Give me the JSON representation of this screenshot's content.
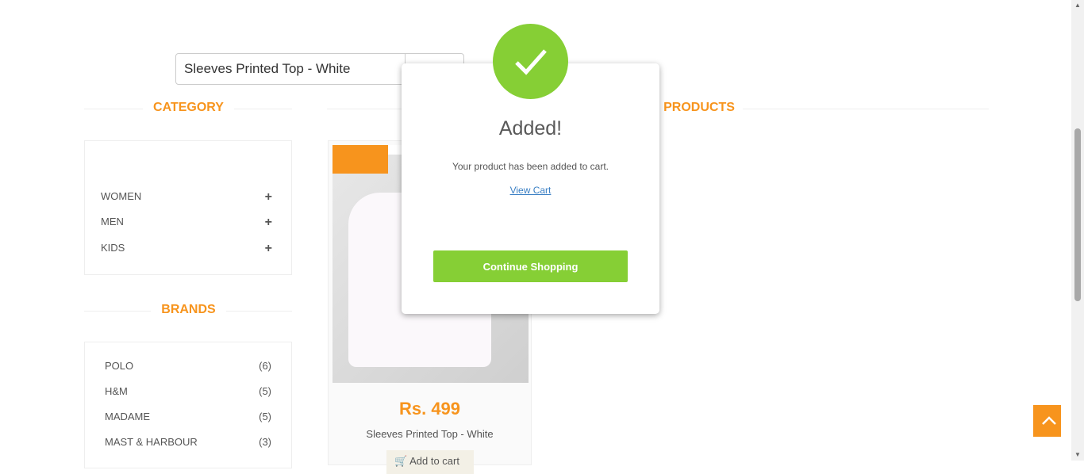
{
  "search": {
    "value": "Sleeves Printed Top - White"
  },
  "sections": {
    "category": "CATEGORY",
    "products": "PRODUCTS",
    "brands": "BRANDS"
  },
  "categories": [
    {
      "label": "WOMEN"
    },
    {
      "label": "MEN"
    },
    {
      "label": "KIDS"
    }
  ],
  "brands": [
    {
      "label": "POLO",
      "count": "(6)"
    },
    {
      "label": "H&M",
      "count": "(5)"
    },
    {
      "label": "MADAME",
      "count": "(5)"
    },
    {
      "label": "MAST & HARBOUR",
      "count": "(3)"
    }
  ],
  "product": {
    "price": "Rs. 499",
    "name": "Sleeves Printed Top - White",
    "add_label": "Add to cart"
  },
  "modal": {
    "title": "Added!",
    "message": "Your product has been added to cart.",
    "link": "View Cart",
    "button": "Continue Shopping"
  },
  "colors": {
    "accent": "#f7941d",
    "success": "#86cf35"
  }
}
